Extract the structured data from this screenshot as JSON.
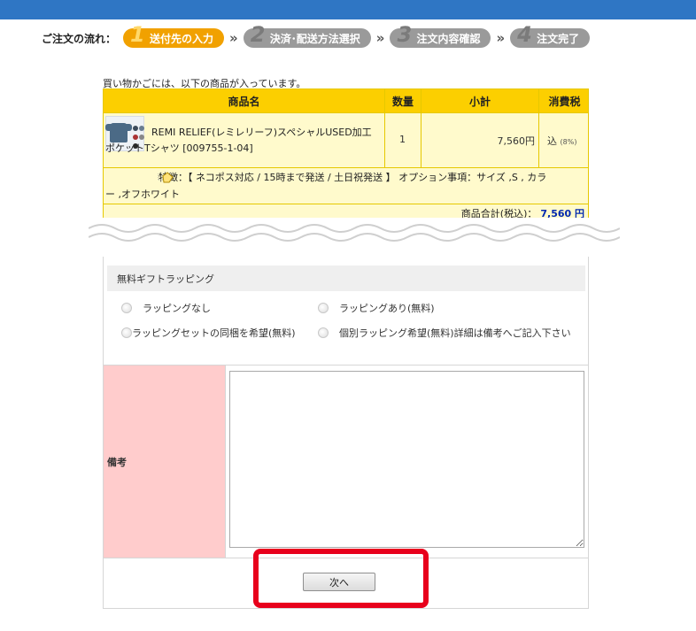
{
  "flow": {
    "label": "ご注文の流れ：",
    "steps": [
      {
        "num": "1",
        "label": "送付先の入力",
        "active": true
      },
      {
        "num": "2",
        "label": "決済･配送方法選択",
        "active": false
      },
      {
        "num": "3",
        "label": "注文内容確認",
        "active": false
      },
      {
        "num": "4",
        "label": "注文完了",
        "active": false
      }
    ],
    "separator": "»"
  },
  "cart": {
    "intro": "買い物かごには、以下の商品が入っています。",
    "columns": [
      "商品名",
      "数量",
      "小計",
      "消費税"
    ],
    "item": {
      "name_line1": "REMI RELIEF(レミレリーフ)スペシャルUSED加工",
      "name_line2": "ポケットTシャツ [009755-1-04]",
      "quantity": "1",
      "subtotal": "7,560円",
      "tax_label": "込",
      "tax_rate": "(8%)",
      "option_line1": "特徴：【 ネコポス対応 / 15時まで発送 / 土日祝発送 】 オプション事項：サイズ ,S , カラ",
      "option_line2": "ー ,オフホワイト"
    },
    "total_label": "商品合計(税込)：",
    "total_value": "7,560 円"
  },
  "gift": {
    "heading": "無料ギフトラッピング",
    "options": [
      "ラッピングなし",
      "ラッピングあり(無料)",
      "ラッピングセットの同梱を希望(無料)",
      "個別ラッピング希望(無料)詳細は備考へご記入下さい"
    ]
  },
  "remarks": {
    "label": "備考",
    "value": ""
  },
  "next_button": "次へ",
  "colors": {
    "topbar": "#2f76c4",
    "step_active": "#f1a100",
    "step_inactive": "#9a9a9a",
    "table_header": "#fccf00",
    "table_body": "#fffacc",
    "remark_label_bg": "#ffcccc",
    "total_value": "#0028b0",
    "highlight": "#e8001c"
  }
}
